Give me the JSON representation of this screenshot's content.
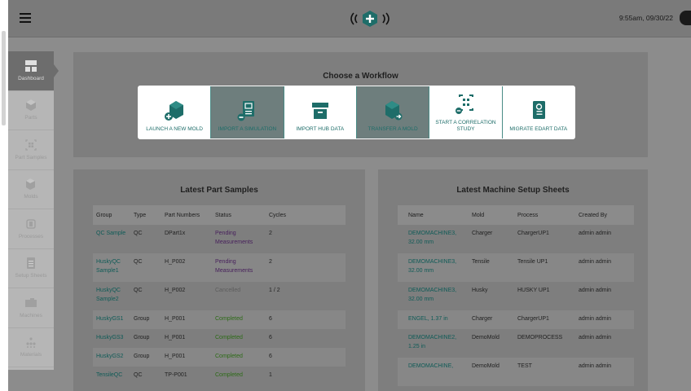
{
  "header": {
    "timestamp": "9:55am, 09/30/22"
  },
  "sidebar": {
    "items": [
      {
        "label": "Dashboard"
      },
      {
        "label": "Parts"
      },
      {
        "label": "Part Samples"
      },
      {
        "label": "Molds"
      },
      {
        "label": "Processes"
      },
      {
        "label": "Setup Sheets"
      },
      {
        "label": "Machines"
      },
      {
        "label": "Materials"
      }
    ]
  },
  "workflow": {
    "title": "Choose a Workflow",
    "tiles": [
      {
        "label": "LAUNCH A NEW MOLD"
      },
      {
        "label": "IMPORT A SIMULATION"
      },
      {
        "label": "IMPORT HUB DATA"
      },
      {
        "label": "TRANSFER A MOLD"
      },
      {
        "label": "START A CORRELATION STUDY"
      },
      {
        "label": "MIGRATE EDART DATA"
      }
    ]
  },
  "part_samples": {
    "title": "Latest Part Samples",
    "columns": [
      "Group",
      "Type",
      "Part Numbers",
      "Status",
      "Cycles"
    ],
    "rows": [
      {
        "group": "QC Sample",
        "type": "QC",
        "part": "DPart1x",
        "status": "Pending Measurements",
        "cycles": "2"
      },
      {
        "group": "HuskyQC Sample1",
        "type": "QC",
        "part": "H_P002",
        "status": "Pending Measurements",
        "cycles": "2"
      },
      {
        "group": "HuskyQC Sample2",
        "type": "QC",
        "part": "H_P002",
        "status": "Cancelled",
        "cycles": "1 / 2"
      },
      {
        "group": "HuskyGS1",
        "type": "Group",
        "part": "H_P001",
        "status": "Completed",
        "cycles": "6"
      },
      {
        "group": "HuskyGS3",
        "type": "Group",
        "part": "H_P001",
        "status": "Completed",
        "cycles": "6"
      },
      {
        "group": "HuskyGS2",
        "type": "Group",
        "part": "H_P001",
        "status": "Completed",
        "cycles": "6"
      },
      {
        "group": "TensileQC",
        "type": "QC",
        "part": "TP-P001",
        "status": "Completed",
        "cycles": "1"
      }
    ]
  },
  "setup_sheets": {
    "title": "Latest Machine Setup Sheets",
    "columns": [
      "Name",
      "Mold",
      "Process",
      "Created By"
    ],
    "rows": [
      {
        "name": "DEMOMACHINE3, 32.00 mm",
        "mold": "Charger",
        "process": "ChargerUP1",
        "by": "admin admin"
      },
      {
        "name": "DEMOMACHINE3, 32.00 mm",
        "mold": "Tensile",
        "process": "Tensile UP1",
        "by": "admin admin"
      },
      {
        "name": "DEMOMACHINE3, 32.00 mm",
        "mold": "Husky",
        "process": "HUSKY UP1",
        "by": "admin admin"
      },
      {
        "name": "ENGEL, 1.37 in",
        "mold": "Charger",
        "process": "ChargerUP1",
        "by": "admin admin"
      },
      {
        "name": "DEMOMACHINE2, 1.25 in",
        "mold": "DemoMold",
        "process": "DEMOPROCESS",
        "by": "admin admin"
      },
      {
        "name": "DEMOMACHINE,",
        "mold": "DemoMold",
        "process": "TEST",
        "by": "admin admin"
      }
    ]
  },
  "colors": {
    "accent": "#1e6d69",
    "pending": "#48215c",
    "completed": "#2d6b17",
    "cancelled": "#5d5d5d"
  }
}
